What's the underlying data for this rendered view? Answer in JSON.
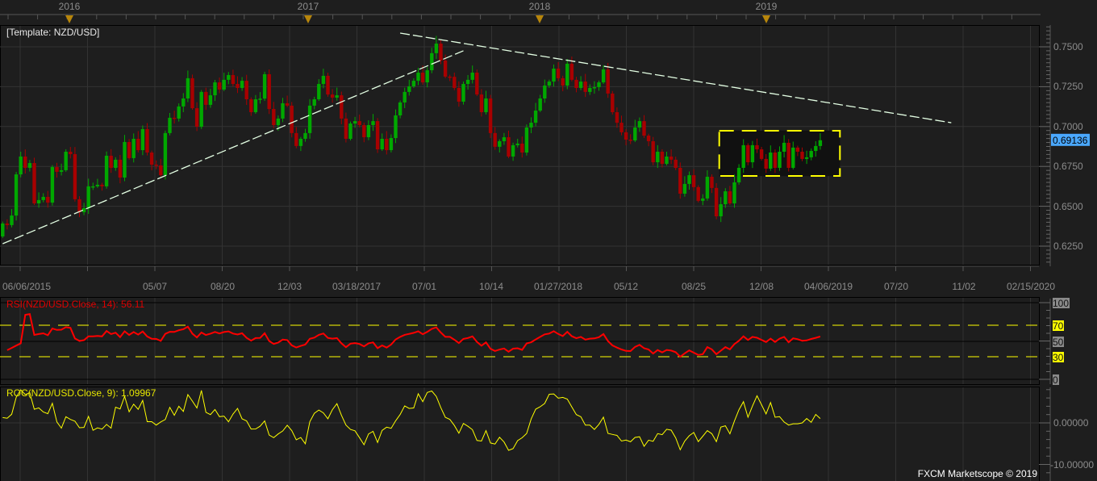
{
  "header": {
    "years": [
      {
        "label": "2016"
      },
      {
        "label": "2017"
      },
      {
        "label": "2018"
      },
      {
        "label": "2019"
      }
    ]
  },
  "template_label": "[Template: NZD/USD]",
  "price_axis": {
    "ticks": [
      "0.7500",
      "0.7250",
      "0.7000",
      "0.6750",
      "0.6500",
      "0.6250"
    ],
    "current_price": "0.69136"
  },
  "date_axis": {
    "labels": [
      "06/06/2015",
      "05/07",
      "08/20",
      "12/03",
      "03/18/2017",
      "07/01",
      "10/14",
      "01/27/2018",
      "05/12",
      "08/25",
      "12/08",
      "04/06/2019",
      "07/20",
      "11/02",
      "02/15/2020"
    ]
  },
  "rsi": {
    "label": "RSI(NZD/USD.Close, 14): 56.11",
    "ticks": [
      "100",
      "70",
      "50",
      "30",
      "0"
    ]
  },
  "roc": {
    "label": "ROC(NZD/USD.Close, 9): 1.09967",
    "ticks": [
      "0.00000",
      "-10.00000"
    ]
  },
  "watermark": "FXCM Marketscope © 2019",
  "colors": {
    "background": "#1e1e1e",
    "grid": "#333333",
    "bull": "#00a800",
    "bear": "#a80000",
    "trendline": "#e4ffe4",
    "range_box": "#ffff00",
    "rsi_line": "#ff0000",
    "roc_line": "#ffff00",
    "current_price_badge": "#4aa8ff"
  },
  "chart_data": {
    "type": "candlestick",
    "symbol": "NZD/USD",
    "timeframe": "weekly",
    "ylim": [
      0.6125,
      0.7625
    ],
    "first_open": 0.6311,
    "closes": [
      0.6392,
      0.6382,
      0.6442,
      0.67,
      0.6812,
      0.6741,
      0.6771,
      0.6518,
      0.6539,
      0.6559,
      0.6523,
      0.6746,
      0.6716,
      0.6726,
      0.6842,
      0.6827,
      0.6544,
      0.6463,
      0.6488,
      0.6625,
      0.6625,
      0.6635,
      0.6625,
      0.6817,
      0.6741,
      0.6792,
      0.668,
      0.6903,
      0.6802,
      0.6923,
      0.6852,
      0.6984,
      0.6837,
      0.6761,
      0.6756,
      0.6695,
      0.6959,
      0.7055,
      0.705,
      0.7126,
      0.7176,
      0.7303,
      0.7115,
      0.6999,
      0.7217,
      0.7136,
      0.7196,
      0.7277,
      0.7232,
      0.7293,
      0.7323,
      0.7267,
      0.7242,
      0.7287,
      0.7171,
      0.709,
      0.7171,
      0.7175,
      0.7328,
      0.711,
      0.7009,
      0.705,
      0.7146,
      0.7131,
      0.6959,
      0.6878,
      0.6923,
      0.6959,
      0.7131,
      0.7171,
      0.7267,
      0.7318,
      0.7201,
      0.7181,
      0.7196,
      0.705,
      0.6923,
      0.7019,
      0.7034,
      0.7009,
      0.6933,
      0.7009,
      0.7034,
      0.6857,
      0.6923,
      0.6852,
      0.6928,
      0.707,
      0.7151,
      0.7217,
      0.7252,
      0.7287,
      0.7338,
      0.7277,
      0.7353,
      0.746,
      0.752,
      0.7414,
      0.7313,
      0.7312,
      0.7242,
      0.7156,
      0.7267,
      0.7293,
      0.7338,
      0.7201,
      0.709,
      0.7176,
      0.6959,
      0.6873,
      0.6908,
      0.6933,
      0.6812,
      0.6883,
      0.6893,
      0.6837,
      0.6994,
      0.7024,
      0.71,
      0.7176,
      0.7257,
      0.7282,
      0.7363,
      0.7303,
      0.7257,
      0.7394,
      0.7293,
      0.7242,
      0.7282,
      0.7217,
      0.7242,
      0.7247,
      0.7277,
      0.7358,
      0.7207,
      0.709,
      0.7024,
      0.6964,
      0.6918,
      0.6913,
      0.6994,
      0.7034,
      0.6943,
      0.6908,
      0.6776,
      0.6842,
      0.6766,
      0.6812,
      0.6792,
      0.6741,
      0.6579,
      0.664,
      0.6695,
      0.662,
      0.6534,
      0.6549,
      0.6685,
      0.6615,
      0.6437,
      0.6513,
      0.6594,
      0.6518,
      0.665,
      0.6741,
      0.6883,
      0.6776,
      0.6883,
      0.6857,
      0.6797,
      0.6736,
      0.6837,
      0.6741,
      0.6842,
      0.6898,
      0.6741,
      0.6868,
      0.6842,
      0.6797,
      0.6807,
      0.6847,
      0.6878,
      0.6914
    ],
    "trendlines": [
      {
        "from": [
          0,
          0.6265
        ],
        "to": [
          102,
          0.7475
        ]
      },
      {
        "from": [
          88,
          0.7586
        ],
        "to": [
          210,
          0.7024
        ]
      }
    ],
    "range_box": {
      "from": 159,
      "to": 185,
      "high": 0.6974,
      "low": 0.669
    },
    "indicators": [
      {
        "name": "RSI",
        "period": 14,
        "ylim": [
          0,
          100
        ],
        "levels": [
          70,
          30
        ]
      },
      {
        "name": "ROC",
        "period": 9,
        "ylim": [
          -10,
          10
        ]
      }
    ]
  }
}
